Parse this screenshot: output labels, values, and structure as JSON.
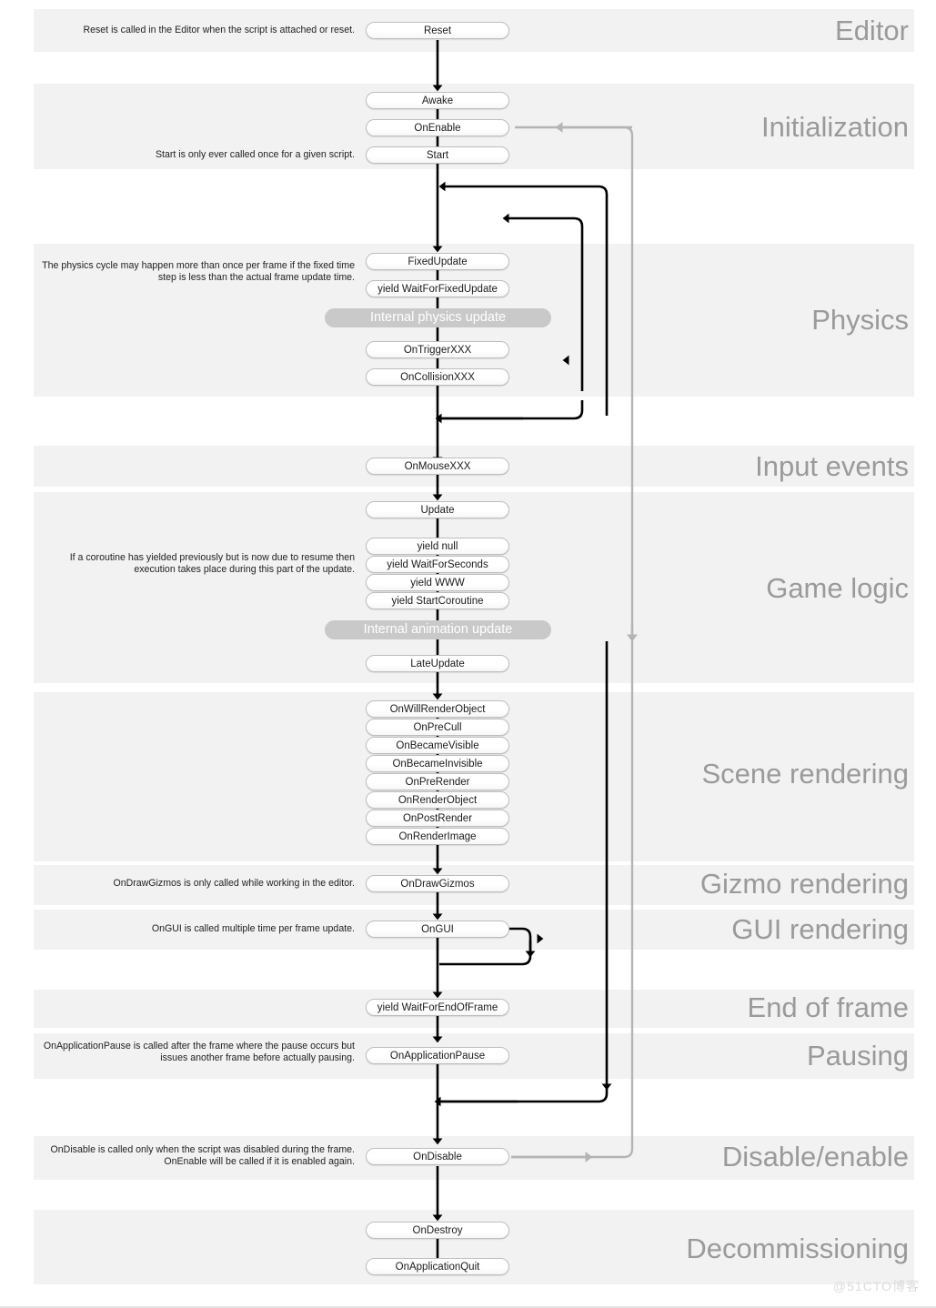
{
  "diagram": {
    "title": "Unity MonoBehaviour Script Lifecycle Flowchart",
    "watermark": "@51CTO博客",
    "colors": {
      "band_background": "#f2f2f2",
      "band_label": "#9a9a9a",
      "node_border": "#bdbdbd",
      "node_background": "#ffffff",
      "internal_node_background": "#c9c9c9",
      "internal_node_text": "#ffffff",
      "flow_arrow": "#000000",
      "secondary_arrow": "#b0b0b0",
      "annotation_text": "#222222"
    }
  },
  "sections": [
    {
      "id": "editor",
      "label": "Editor"
    },
    {
      "id": "initialization",
      "label": "Initialization"
    },
    {
      "id": "physics",
      "label": "Physics"
    },
    {
      "id": "input-events",
      "label": "Input events"
    },
    {
      "id": "game-logic",
      "label": "Game logic"
    },
    {
      "id": "scene-rendering",
      "label": "Scene rendering"
    },
    {
      "id": "gizmo-rendering",
      "label": "Gizmo rendering"
    },
    {
      "id": "gui-rendering",
      "label": "GUI rendering"
    },
    {
      "id": "end-of-frame",
      "label": "End of frame"
    },
    {
      "id": "pausing",
      "label": "Pausing"
    },
    {
      "id": "disable-enable",
      "label": "Disable/enable"
    },
    {
      "id": "decommissioning",
      "label": "Decommissioning"
    }
  ],
  "nodes": [
    {
      "id": "reset",
      "label": "Reset",
      "kind": "callback",
      "section": "editor"
    },
    {
      "id": "awake",
      "label": "Awake",
      "kind": "callback",
      "section": "initialization"
    },
    {
      "id": "on-enable",
      "label": "OnEnable",
      "kind": "callback",
      "section": "initialization"
    },
    {
      "id": "start",
      "label": "Start",
      "kind": "callback",
      "section": "initialization"
    },
    {
      "id": "fixed-update",
      "label": "FixedUpdate",
      "kind": "callback",
      "section": "physics"
    },
    {
      "id": "yield-wait-for-fixed",
      "label": "yield WaitForFixedUpdate",
      "kind": "yield",
      "section": "physics"
    },
    {
      "id": "internal-physics-update",
      "label": "Internal physics update",
      "kind": "internal",
      "section": "physics"
    },
    {
      "id": "on-trigger-xxx",
      "label": "OnTriggerXXX",
      "kind": "callback",
      "section": "physics"
    },
    {
      "id": "on-collision-xxx",
      "label": "OnCollisionXXX",
      "kind": "callback",
      "section": "physics"
    },
    {
      "id": "on-mouse-xxx",
      "label": "OnMouseXXX",
      "kind": "callback",
      "section": "input-events"
    },
    {
      "id": "update",
      "label": "Update",
      "kind": "callback",
      "section": "game-logic"
    },
    {
      "id": "yield-null",
      "label": "yield null",
      "kind": "yield",
      "section": "game-logic"
    },
    {
      "id": "yield-wait-for-seconds",
      "label": "yield WaitForSeconds",
      "kind": "yield",
      "section": "game-logic"
    },
    {
      "id": "yield-www",
      "label": "yield WWW",
      "kind": "yield",
      "section": "game-logic"
    },
    {
      "id": "yield-start-coroutine",
      "label": "yield StartCoroutine",
      "kind": "yield",
      "section": "game-logic"
    },
    {
      "id": "internal-animation-update",
      "label": "Internal animation update",
      "kind": "internal",
      "section": "game-logic"
    },
    {
      "id": "late-update",
      "label": "LateUpdate",
      "kind": "callback",
      "section": "game-logic"
    },
    {
      "id": "on-will-render-object",
      "label": "OnWillRenderObject",
      "kind": "callback",
      "section": "scene-rendering"
    },
    {
      "id": "on-pre-cull",
      "label": "OnPreCull",
      "kind": "callback",
      "section": "scene-rendering"
    },
    {
      "id": "on-became-visible",
      "label": "OnBecameVisible",
      "kind": "callback",
      "section": "scene-rendering"
    },
    {
      "id": "on-became-invisible",
      "label": "OnBecameInvisible",
      "kind": "callback",
      "section": "scene-rendering"
    },
    {
      "id": "on-pre-render",
      "label": "OnPreRender",
      "kind": "callback",
      "section": "scene-rendering"
    },
    {
      "id": "on-render-object",
      "label": "OnRenderObject",
      "kind": "callback",
      "section": "scene-rendering"
    },
    {
      "id": "on-post-render",
      "label": "OnPostRender",
      "kind": "callback",
      "section": "scene-rendering"
    },
    {
      "id": "on-render-image",
      "label": "OnRenderImage",
      "kind": "callback",
      "section": "scene-rendering"
    },
    {
      "id": "on-draw-gizmos",
      "label": "OnDrawGizmos",
      "kind": "callback",
      "section": "gizmo-rendering"
    },
    {
      "id": "on-gui",
      "label": "OnGUI",
      "kind": "callback",
      "section": "gui-rendering"
    },
    {
      "id": "yield-wait-for-end-of-frame",
      "label": "yield WaitForEndOfFrame",
      "kind": "yield",
      "section": "end-of-frame"
    },
    {
      "id": "on-application-pause",
      "label": "OnApplicationPause",
      "kind": "callback",
      "section": "pausing"
    },
    {
      "id": "on-disable",
      "label": "OnDisable",
      "kind": "callback",
      "section": "disable-enable"
    },
    {
      "id": "on-destroy",
      "label": "OnDestroy",
      "kind": "callback",
      "section": "decommissioning"
    },
    {
      "id": "on-application-quit",
      "label": "OnApplicationQuit",
      "kind": "callback",
      "section": "decommissioning"
    }
  ],
  "annotations": [
    {
      "id": "note-reset",
      "for": "reset",
      "text": "Reset is called in the Editor when the script is attached or reset."
    },
    {
      "id": "note-start",
      "for": "start",
      "text": "Start is only ever called once for a given script."
    },
    {
      "id": "note-physics",
      "for": "fixed-update",
      "text": "The physics cycle may happen more than once per frame if the fixed time step is less than the actual frame update time."
    },
    {
      "id": "note-coroutine",
      "for": "yield-wait-for-seconds",
      "text": "If a coroutine has yielded previously but is now due to resume then execution takes place during this part of the update."
    },
    {
      "id": "note-gizmos",
      "for": "on-draw-gizmos",
      "text": "OnDrawGizmos is only called while working in the editor."
    },
    {
      "id": "note-gui",
      "for": "on-gui",
      "text": "OnGUI is called multiple time per frame update."
    },
    {
      "id": "note-pause",
      "for": "on-application-pause",
      "text": "OnApplicationPause is called after the frame where the pause occurs but issues another frame before actually pausing."
    },
    {
      "id": "note-disable",
      "for": "on-disable",
      "text": "OnDisable is called only when the script was disabled during the frame. OnEnable will be called if it is enabled again."
    }
  ]
}
